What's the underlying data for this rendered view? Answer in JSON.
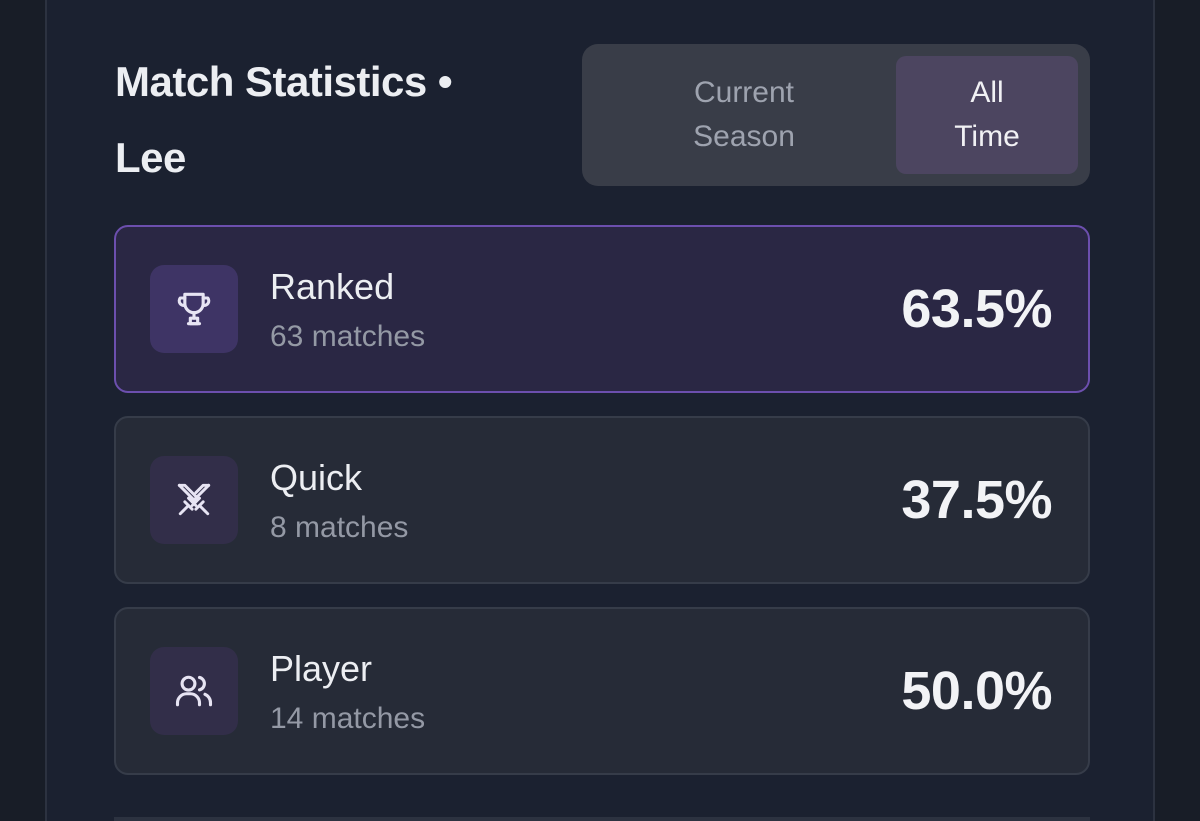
{
  "header": {
    "title_line1": "Match Statistics •",
    "title_line2": "Lee"
  },
  "toggle": {
    "options": [
      {
        "line1": "Current",
        "line2": "Season",
        "selected": false
      },
      {
        "line1": "All",
        "line2": "Time",
        "selected": true
      }
    ]
  },
  "modes": [
    {
      "icon": "trophy-icon",
      "name": "Ranked",
      "matches": "63 matches",
      "win_rate": "63.5%",
      "highlighted": true
    },
    {
      "icon": "crossed-swords-icon",
      "name": "Quick",
      "matches": "8 matches",
      "win_rate": "37.5%",
      "highlighted": false
    },
    {
      "icon": "users-icon",
      "name": "Player",
      "matches": "14 matches",
      "win_rate": "50.0%",
      "highlighted": false
    }
  ],
  "colors": {
    "background": "#1b2130",
    "accent": "#6c4fae",
    "card": "#262b37",
    "card_active": "#2a2744"
  }
}
